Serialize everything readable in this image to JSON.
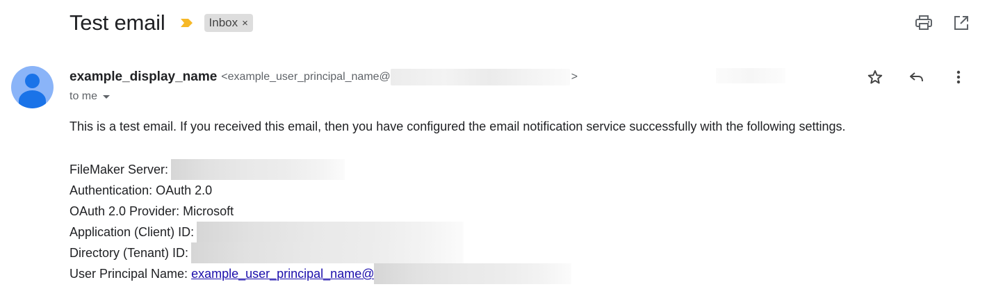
{
  "subject": {
    "title": "Test email",
    "label": "Inbox",
    "label_remove": "×"
  },
  "top_actions": {
    "print_icon": "print-icon",
    "open_new_window_icon": "open-in-new-window-icon"
  },
  "sender": {
    "name": "example_display_name",
    "email_prefix": "<example_user_principal_name@",
    "email_suffix": ">",
    "recipient_label": "to me"
  },
  "message_actions": {
    "star_icon": "star-icon",
    "reply_icon": "reply-icon",
    "more_icon": "more-vertical-icon"
  },
  "body": {
    "intro": "This is a test email. If you received this email, then you have configured the email notification service successfully with the following settings.",
    "settings": [
      {
        "label": "FileMaker Server:",
        "value": ""
      },
      {
        "label": "Authentication: OAuth 2.0",
        "value": ""
      },
      {
        "label": "OAuth 2.0 Provider: Microsoft",
        "value": ""
      },
      {
        "label": "Application (Client) ID:",
        "value": ""
      },
      {
        "label": "Directory (Tenant) ID:",
        "value": ""
      },
      {
        "label": "User Principal Name:",
        "value": "example_user_principal_name@"
      }
    ]
  },
  "colors": {
    "important_marker": "#f6b827",
    "avatar_bg": "#8ab4f8",
    "avatar_fg": "#1a73e8",
    "link": "#1a0dab"
  }
}
